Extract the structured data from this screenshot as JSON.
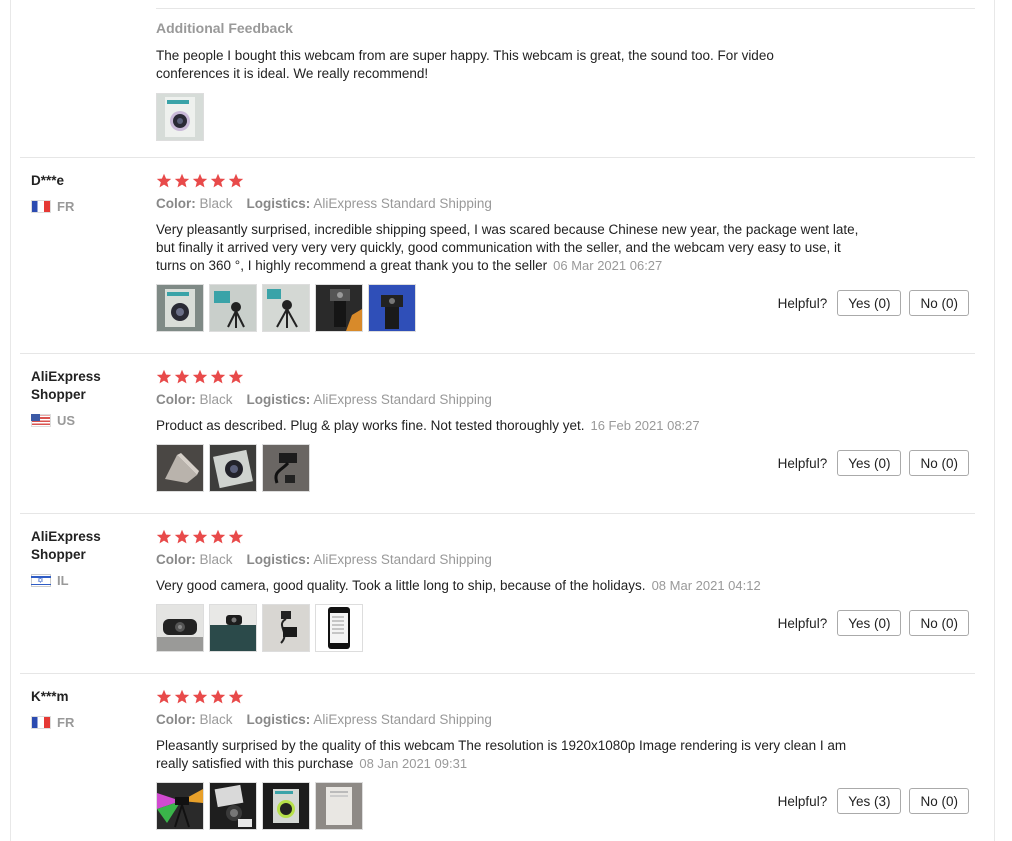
{
  "accent_color": "#e84a4a",
  "top_review": {
    "additional_feedback_title": "Additional Feedback",
    "additional_feedback_text": "The people I bought this webcam from are super happy. This webcam is great, the sound too. For video conferences it is ideal. We really recommend!",
    "photo_count": 1
  },
  "labels": {
    "color": "Color:",
    "logistics": "Logistics:",
    "helpful": "Helpful?"
  },
  "reviews": [
    {
      "user": "D***e",
      "country": "FR",
      "rating": 5,
      "color": "Black",
      "logistics": "AliExpress Standard Shipping",
      "text": "Very pleasantly surprised, incredible shipping speed, I was scared because Chinese new year, the package went late, but finally it arrived very very very quickly, good communication with the seller, and the webcam very easy to use, it turns on 360 °, I highly recommend a great thank you to the seller",
      "date": "06 Mar 2021 06:27",
      "photo_count": 5,
      "yes": "Yes (0)",
      "no": "No (0)"
    },
    {
      "user": "AliExpress Shopper",
      "country": "US",
      "rating": 5,
      "color": "Black",
      "logistics": "AliExpress Standard Shipping",
      "text": "Product as described. Plug & play works fine. Not tested thoroughly yet.",
      "date": "16 Feb 2021 08:27",
      "photo_count": 3,
      "yes": "Yes (0)",
      "no": "No (0)"
    },
    {
      "user": "AliExpress Shopper",
      "country": "IL",
      "rating": 5,
      "color": "Black",
      "logistics": "AliExpress Standard Shipping",
      "text": "Very good camera, good quality. Took a little long to ship, because of the holidays.",
      "date": "08 Mar 2021 04:12",
      "photo_count": 4,
      "yes": "Yes (0)",
      "no": "No (0)"
    },
    {
      "user": "K***m",
      "country": "FR",
      "rating": 5,
      "color": "Black",
      "logistics": "AliExpress Standard Shipping",
      "text": "Pleasantly surprised by the quality of this webcam The resolution is 1920x1080p Image rendering is very clean I am really satisfied with this purchase",
      "date": "08 Jan 2021 09:31",
      "photo_count": 4,
      "yes": "Yes (3)",
      "no": "No (0)"
    }
  ]
}
